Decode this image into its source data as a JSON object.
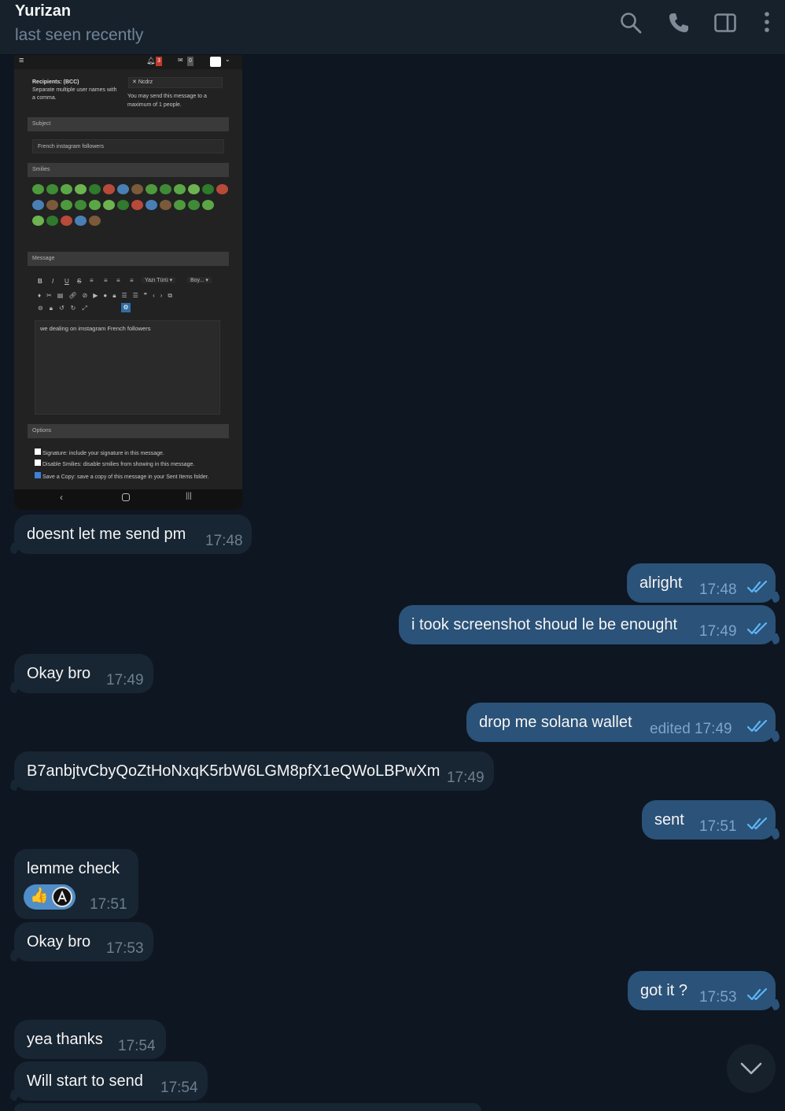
{
  "header": {
    "name": "Yurizan",
    "status": "last seen recently",
    "icons": [
      "search-icon",
      "phone-icon",
      "sidebar-toggle-icon",
      "more-vertical-icon"
    ]
  },
  "screenshot": {
    "notif_count": "3",
    "inbox_count": "0",
    "recipients_label": "Recipients: (BCC)",
    "recipients_hint": "Separate multiple user names with a comma.",
    "recipient_tag": "Ncdrz",
    "recipient_limit": "You may send this message to a maximum of 1 people.",
    "subject_label": "Subject",
    "subject_value": "French instagram followers",
    "smilies_label": "Smilies",
    "message_label": "Message",
    "font_dropdown": "Yazı Türü",
    "size_dropdown": "Boy...",
    "message_body": "we dealing on imstagram French followers",
    "options_label": "Options",
    "opt_signature": "Signature: include your signature in this message.",
    "opt_disable_smilies": "Disable Smilies: disable smilies from showing in this message.",
    "opt_save_copy": "Save a Copy: save a copy of this message in your Sent Items folder."
  },
  "messages": [
    {
      "dir": "in",
      "text": "doesnt let me send pm",
      "time": "17:48"
    },
    {
      "dir": "out",
      "text": "alright",
      "time": "17:48"
    },
    {
      "dir": "out",
      "text": "i  took screenshot shoud le be enought",
      "time": "17:49"
    },
    {
      "dir": "in",
      "text": "Okay bro",
      "time": "17:49"
    },
    {
      "dir": "out",
      "text": "drop me solana wallet",
      "time": "edited 17:49"
    },
    {
      "dir": "in",
      "text": "B7anbjtvCbyQoZtHoNxqK5rbW6LGM8pfX1eQWoLBPwXm",
      "time": "17:49"
    },
    {
      "dir": "out",
      "text": "sent",
      "time": "17:51"
    },
    {
      "dir": "in",
      "text": "lemme check",
      "time": "17:51",
      "reaction": "👍"
    },
    {
      "dir": "in",
      "text": "Okay bro",
      "time": "17:53"
    },
    {
      "dir": "out",
      "text": "got it ?",
      "time": "17:53"
    },
    {
      "dir": "in",
      "text": "yea thanks",
      "time": "17:54"
    },
    {
      "dir": "in",
      "text": "Will start to send",
      "time": "17:54"
    }
  ],
  "colors": {
    "background": "#0e1621",
    "header": "#17212b",
    "incoming_bubble": "#182533",
    "outgoing_bubble": "#2b5278",
    "read_ticks": "#5eb5f7"
  }
}
